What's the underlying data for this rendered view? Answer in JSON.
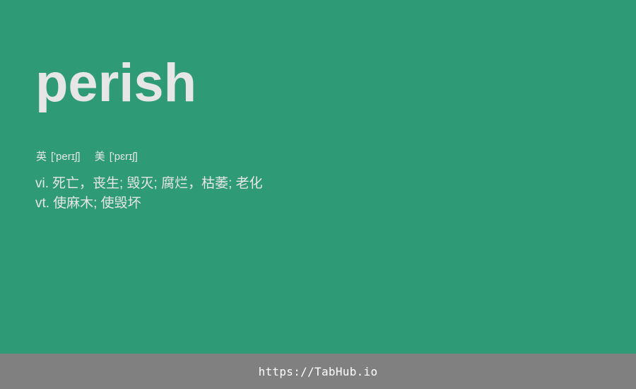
{
  "word": "perish",
  "phonetics": [
    {
      "lang": "英",
      "ipa": "['perɪʃ]"
    },
    {
      "lang": "美",
      "ipa": "['pɛrɪʃ]"
    }
  ],
  "definitions": [
    {
      "pos": "vi.",
      "meaning": "死亡，丧生; 毁灭; 腐烂，枯萎; 老化"
    },
    {
      "pos": "vt.",
      "meaning": "使麻木; 使毁坏"
    }
  ],
  "footer": {
    "link": "https://TabHub.io"
  },
  "colors": {
    "background": "#2e9b76",
    "footer_background": "#808080",
    "text": "#e6e6e6"
  }
}
